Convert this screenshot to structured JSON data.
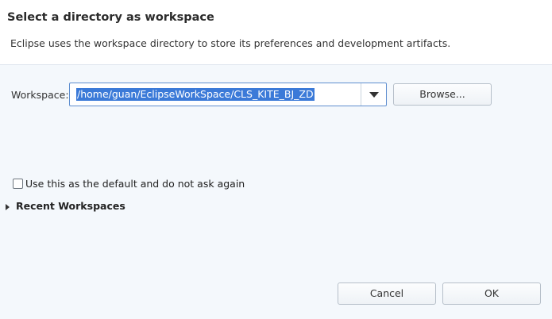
{
  "header": {
    "title": "Select a directory as workspace",
    "message": "Eclipse uses the workspace directory to store its preferences and development artifacts."
  },
  "workspace": {
    "label": "Workspace:",
    "value": "/home/guan/EclipseWorkSpace/CLS_KITE_BJ_ZD",
    "selected": true,
    "dropdown_icon": "chevron-down-icon",
    "browse_label": "Browse..."
  },
  "default_checkbox": {
    "label": "Use this as the default and do not ask again",
    "checked": false
  },
  "recent": {
    "label": "Recent Workspaces",
    "expanded": false,
    "icon": "expand-triangle-icon"
  },
  "buttons": {
    "cancel": "Cancel",
    "ok": "OK"
  },
  "colors": {
    "selection": "#3b7ad8",
    "focus_border": "#5e8ecf",
    "header_bg": "#ffffff",
    "body_bg": "#f4f8fc"
  }
}
